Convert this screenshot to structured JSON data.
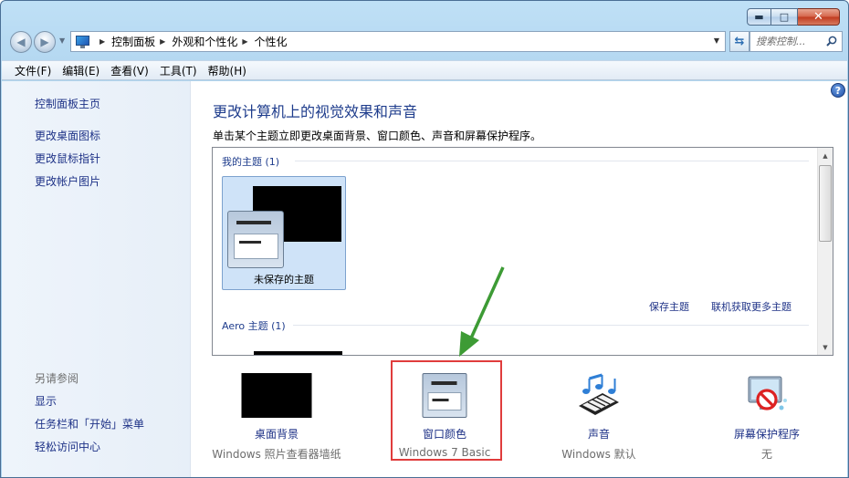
{
  "window": {
    "caption_minimize": "▬",
    "caption_maximize": "□",
    "caption_close": "✕"
  },
  "address": {
    "breadcrumbs": [
      "控制面板",
      "外观和个性化",
      "个性化"
    ],
    "search_placeholder": "搜索控制...",
    "back_icon": "back-arrow-icon",
    "forward_icon": "forward-arrow-icon"
  },
  "menu": [
    "文件(F)",
    "编辑(E)",
    "查看(V)",
    "工具(T)",
    "帮助(H)"
  ],
  "sidebar": {
    "home": "控制面板主页",
    "links": [
      "更改桌面图标",
      "更改鼠标指针",
      "更改帐户图片"
    ],
    "see_also_title": "另请参阅",
    "see_also": [
      "显示",
      "任务栏和「开始」菜单",
      "轻松访问中心"
    ]
  },
  "main": {
    "title": "更改计算机上的视觉效果和声音",
    "subtitle": "单击某个主题立即更改桌面背景、窗口颜色、声音和屏幕保护程序。",
    "my_themes_header": "我的主题 (1)",
    "unsaved_theme_label": "未保存的主题",
    "save_theme_link": "保存主题",
    "get_more_link": "联机获取更多主题",
    "aero_header": "Aero 主题 (1)"
  },
  "tiles": [
    {
      "link": "桌面背景",
      "desc": "Windows 照片查看器墙纸",
      "icon": "desktop-background-icon"
    },
    {
      "link": "窗口颜色",
      "desc": "Windows 7 Basic",
      "icon": "window-color-icon"
    },
    {
      "link": "声音",
      "desc": "Windows 默认",
      "icon": "sound-icon"
    },
    {
      "link": "屏幕保护程序",
      "desc": "无",
      "icon": "screensaver-icon"
    }
  ],
  "colors": {
    "link": "#1e3287",
    "title": "#1e3c8c",
    "highlight_box": "#e03c3c",
    "arrow": "#3d9b35"
  }
}
